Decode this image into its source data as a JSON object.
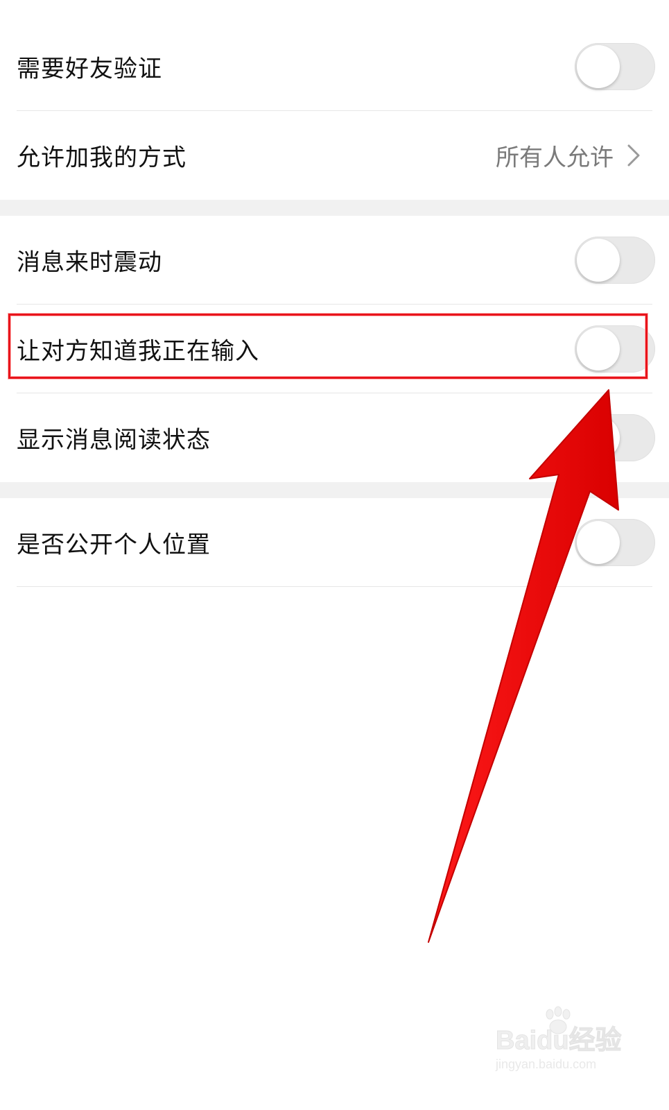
{
  "settings": {
    "rows": [
      {
        "label": "需要好友验证",
        "control": "toggle",
        "on": false
      },
      {
        "label": "允许加我的方式",
        "control": "value",
        "value": "所有人允许"
      },
      {
        "label": "消息来时震动",
        "control": "toggle",
        "on": false
      },
      {
        "label": "让对方知道我正在输入",
        "control": "toggle",
        "on": false,
        "highlighted": true
      },
      {
        "label": "显示消息阅读状态",
        "control": "toggle",
        "on": false
      },
      {
        "label": "是否公开个人位置",
        "control": "toggle",
        "on": false
      }
    ]
  },
  "annotation": {
    "highlight_color": "#e8141b",
    "arrow_color": "#ee0000"
  },
  "watermark": {
    "logo_text": "Baidu经验",
    "url_text": "jingyan.baidu.com"
  },
  "icons": {
    "chevron": "chevron-right-icon",
    "paw": "baidu-paw-icon"
  },
  "colors": {
    "toggle_off_track": "#e9e9e9",
    "section_gap": "#f1f1f1",
    "value_text": "#7a7a7a"
  }
}
